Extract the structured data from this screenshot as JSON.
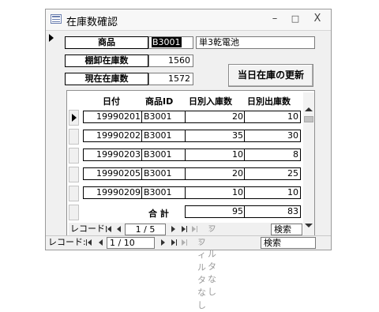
{
  "window": {
    "title": "在庫数確認",
    "minimize": "–",
    "maximize": "□",
    "close": "X"
  },
  "form": {
    "product_label": "商品",
    "product_code": "B3001",
    "product_name": "単3乾電池",
    "inventory_label": "棚卸在庫数",
    "inventory_value": "1560",
    "current_label": "現在在庫数",
    "current_value": "1572",
    "update_button": "当日在庫の更新"
  },
  "subform": {
    "headers": [
      "日付",
      "商品ID",
      "日別入庫数",
      "日別出庫数"
    ],
    "rows": [
      {
        "date": "19990201",
        "id": "B3001",
        "in": "20",
        "out": "10"
      },
      {
        "date": "19990202",
        "id": "B3001",
        "in": "35",
        "out": "30"
      },
      {
        "date": "19990203",
        "id": "B3001",
        "in": "10",
        "out": "8"
      },
      {
        "date": "19990205",
        "id": "B3001",
        "in": "20",
        "out": "25"
      },
      {
        "date": "19990209",
        "id": "B3001",
        "in": "10",
        "out": "10"
      }
    ],
    "total_label": "合 計",
    "total_in": "95",
    "total_out": "83",
    "nav": {
      "record_label": "レコード:",
      "position": "1 / 5",
      "filter": "フィルタなし",
      "search": "検索"
    }
  },
  "main_nav": {
    "record_label": "レコード:",
    "position": "1 / 10",
    "filter": "フィルタなし",
    "search": "検索"
  }
}
